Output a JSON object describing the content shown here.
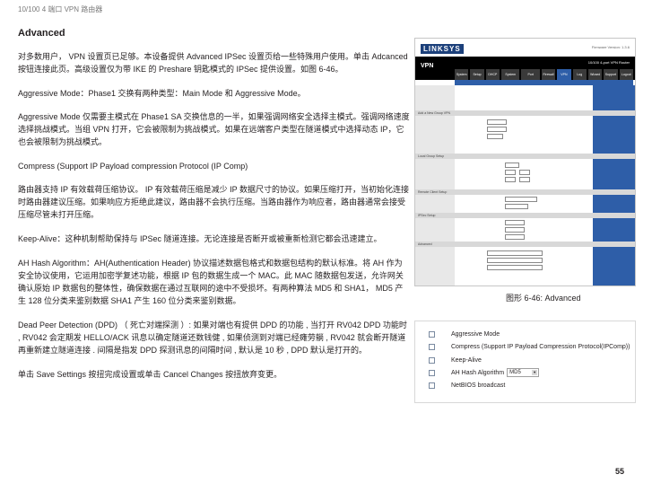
{
  "header": "10/100 4 端口 VPN 路由器",
  "title": "Advanced",
  "paragraphs": {
    "p1": "对多数用户， VPN 设置页已足够。本设备提供 Advanced IPSec 设置页给一些特殊用户使用。单击 Adcanced 按钮连接此页。高级设置仅为带 IKE 的 Preshare 钥匙模式的 IPSec 提供设置。如图 6-46。",
    "p2": "Aggressive Mode：Phase1 交换有两种类型：Main Mode 和 Aggressive Mode。",
    "p3": "Aggressive Mode 仅需要主模式在 Phase1 SA 交换信息的一半，如果强调网络安全选择主模式。强调网络速度选择挑战模式。当组 VPN 打开，它会被限制为挑战模式。如果在远端客户类型在隧道模式中选择动态 IP，它也会被限制为挑战模式。",
    "p4": "Compress (Support IP Payload compression Protocol (IP Comp)",
    "p5": "路由器支持 IP 有效载荷压缩协议。 IP 有效载荷压缩是减少 IP 数据尺寸的协议。如果压缩打开，当初始化连接时路由器建议压缩。如果响应方拒绝此建议，路由器不会执行压缩。当路由器作为响应者，路由器通常会接受压缩尽管未打开压缩。",
    "p6": "Keep-Alive：这种机制帮助保持与 IPSec 隧道连接。无论连接是否断开或被重新检测它都会迅速建立。",
    "p7": "AH Hash Algorithm：AH(Authentication Header) 协议描述数据包格式和数据包结构的默认标准。将 AH 作为安全协议使用，它运用加密学复述功能，根据 IP 包的数据生成一个 MAC。此 MAC 随数据包发送，允许网关确认原始 IP 数据包的整体性，确保数据在通过互联网的途中不受损坏。有两种算法 MD5 和 SHA1， MD5 产生 128 位分类来鉴别数据 SHA1 产生 160 位分类来鉴别数据。",
    "p8": "Dead Peer Detection (DPD) （ 死亡对端探测 ）: 如果对端也有提供 DPD 的功能 , 当打开 RV042 DPD 功能时 , RV042 会定期发 HELLO/ACK 讯息以确定隧道还数钱健 , 如果侦测到对端已经瘫劳躺 , RV042 就会断开隧道再重新建立隧道连接 . 间隔是指发 DPD 探测讯息的间隔时间 , 默认是 10 秒 , DPD 默认是打开的。",
    "p9": "单击 Save Settings 按扭完成设置或单击 Cancel Changes 按扭放弃变更。"
  },
  "screenshot": {
    "logo": "LINKSYS",
    "firmware": "Firmware Version: 1.3.6",
    "product": "10/100 4-port VPN Router",
    "section": "VPN",
    "tabs": [
      "System Summary",
      "Setup",
      "DHCP",
      "System Management",
      "Port Management",
      "Firewall",
      "VPN",
      "Log",
      "Wizard",
      "Support",
      "Logout"
    ],
    "rows": [
      "Add a New Group VPN",
      "Local Group Setup",
      "Remote Client Setup",
      "IPSec Setup",
      "Advanced"
    ]
  },
  "caption": "图形 6-46: Advanced",
  "options": {
    "items": [
      "Aggressive Mode",
      "Compress (Support IP Payload Compression Protocol(IPComp))",
      "Keep-Alive",
      "AH Hash Algorithm",
      "NetBIOS broadcast"
    ],
    "hash_value": "MD5"
  },
  "page_number": "55"
}
